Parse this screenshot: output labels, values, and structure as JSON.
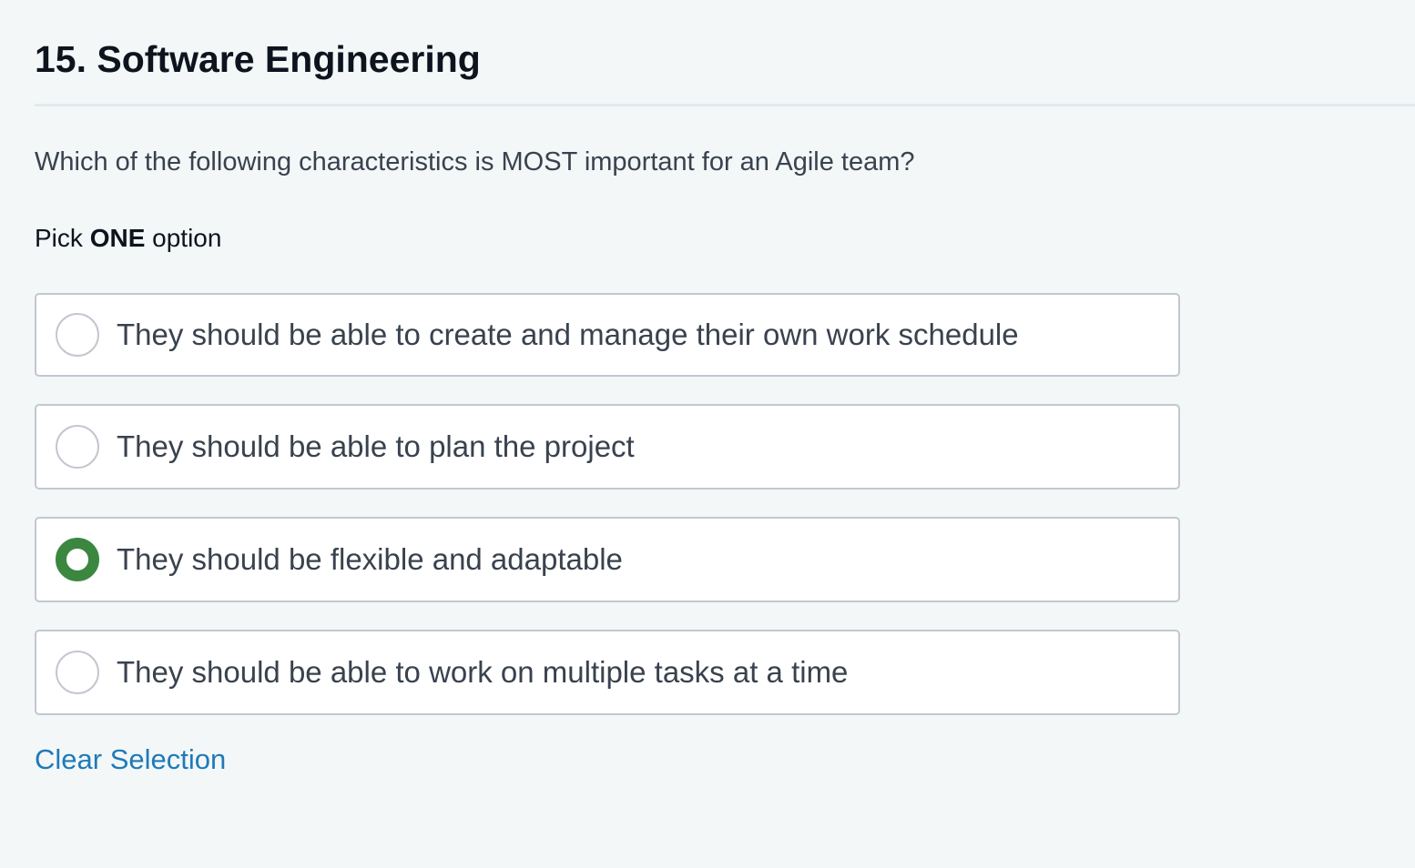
{
  "question": {
    "title": "15. Software Engineering",
    "prompt": "Which of the following characteristics is MOST important for an Agile team?",
    "instruction_prefix": "Pick ",
    "instruction_emphasis": "ONE",
    "instruction_suffix": " option"
  },
  "options": [
    {
      "label": "They should be able to create and manage their own work schedule",
      "selected": false
    },
    {
      "label": "They should be able to plan the project",
      "selected": false
    },
    {
      "label": "They should be flexible and adaptable",
      "selected": true
    },
    {
      "label": "They should be able to work on multiple tasks at a time",
      "selected": false
    }
  ],
  "actions": {
    "clear_label": "Clear Selection"
  },
  "colors": {
    "selected_radio": "#3b8740",
    "link": "#1f7ab8",
    "background": "#f3f7f8"
  }
}
